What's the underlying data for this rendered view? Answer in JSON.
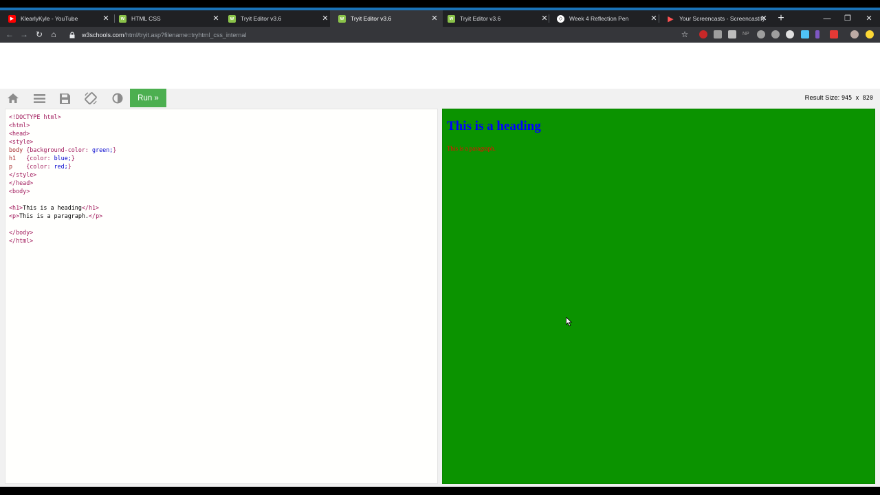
{
  "browser": {
    "tabs": [
      {
        "label": "KlearlyKyle - YouTube",
        "icon": "youtube-icon",
        "color": "#ff0000"
      },
      {
        "label": "HTML CSS",
        "icon": "w3schools-icon",
        "color": "#8bc34a"
      },
      {
        "label": "Tryit Editor v3.6",
        "icon": "w3schools-icon",
        "color": "#8bc34a"
      },
      {
        "label": "Tryit Editor v3.6",
        "icon": "w3schools-icon",
        "color": "#8bc34a",
        "active": true
      },
      {
        "label": "Tryit Editor v3.6",
        "icon": "w3schools-icon",
        "color": "#8bc34a"
      },
      {
        "label": "Week 4 Reflection Pen",
        "icon": "codepen-icon",
        "color": "#ffffff"
      },
      {
        "label": "Your Screencasts - Screencastify",
        "icon": "screencastify-icon",
        "color": "#ff5252"
      }
    ],
    "url_domain": "w3schools.com",
    "url_path": "/html/tryit.asp?filename=tryhtml_css_internal"
  },
  "toolbar": {
    "run_label": "Run »",
    "result_size_label": "Result Size:",
    "result_size_value": "945 x 820"
  },
  "editor": {
    "lines": [
      "<!DOCTYPE html>",
      "<html>",
      "<head>",
      "<style>",
      "body {background-color: green;}",
      "h1   {color: blue;}",
      "p    {color: red;}",
      "</style>",
      "</head>",
      "<body>",
      "",
      "<h1>This is a heading</h1>",
      "<p>This is a paragraph.</p>",
      "",
      "</body>",
      "</html>"
    ]
  },
  "result": {
    "heading": "This is a heading",
    "paragraph": "This is a paragraph.",
    "background": "#0b9300",
    "heading_color": "#0000ff",
    "paragraph_color": "#ff0000"
  }
}
